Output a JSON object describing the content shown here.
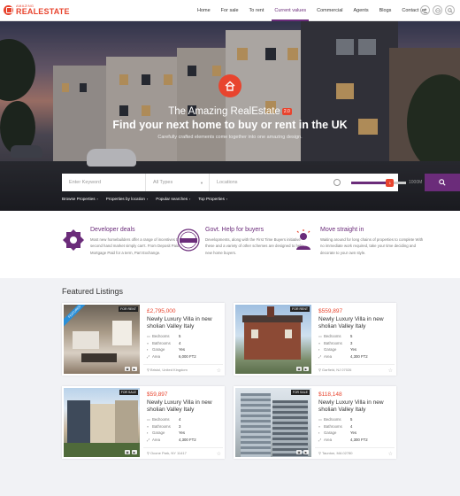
{
  "brand": {
    "small": "AMAZING",
    "big": "REALESTATE",
    "accent": "#e8442e",
    "primary": "#6b2c7a"
  },
  "nav": {
    "items": [
      "Home",
      "For sale",
      "To rent",
      "Current values",
      "Commercial",
      "Agents",
      "Blogs",
      "Contact us"
    ],
    "active": "Current values"
  },
  "header_icons": [
    "user-icon",
    "globe-icon",
    "search-icon"
  ],
  "hero": {
    "title1": "The Amazing RealEstate",
    "version": "2.0",
    "title2": "Find your next home to buy or rent in the UK",
    "subtitle": "Carefully crafted elements come together into one amazing design."
  },
  "search": {
    "keyword_placeholder": "Enter Keyword",
    "type_placeholder": "All Types",
    "location_placeholder": "Locations",
    "range_label": "1000M",
    "range_value": "1",
    "range_fill_fraction": 0.7
  },
  "quick_links": [
    "Browse Properties",
    "Properties by location",
    "Popular searches",
    "Top Properties"
  ],
  "features": [
    {
      "title": "Developer deals",
      "text": "Most new homebuilders offer a range of incentives that the second hand market simply can't. From Deposit Paid to Mortgage Paid for a term, Part Exchange."
    },
    {
      "title": "Govt. Help for buyers",
      "text": "Developments, along with the First Time Buyers initiative these and a variety of other schemes are designed to help new home buyers."
    },
    {
      "title": "Move straight in",
      "text": "Waiting around for long chains of properties to complete With no immediate work required, take your time deciding and decorate to your own style."
    }
  ],
  "featured": {
    "heading": "Featured Listings",
    "spec_labels": [
      "Bedrooms",
      "Bathrooms",
      "Garage",
      "Area"
    ],
    "listings": [
      {
        "price": "£2,795,000",
        "title": "Newly Luxury Villa in new sholian Valley Italy",
        "tag": "FOR RENT",
        "featured": "FEATURED",
        "specs": [
          "5",
          "4",
          "Yes",
          "6,000 FT2"
        ],
        "location": "Bristol, United Kingdom"
      },
      {
        "price": "$559,897",
        "title": "Newly Luxury Villa in new sholian Valley Italy",
        "tag": "FOR RENT",
        "specs": [
          "5",
          "3",
          "Yes",
          "4,300 FT2"
        ],
        "location": "Garfield, NJ 07026"
      },
      {
        "price": "$59,897",
        "title": "Newly Luxury Villa in new sholian Valley Italy",
        "tag": "FOR SALE",
        "specs": [
          "4",
          "3",
          "Yes",
          "4,300 FT2"
        ],
        "location": "Ocone Park, NY 11417"
      },
      {
        "price": "$118,148",
        "title": "Newly Luxury Villa in new sholian Valley Italy",
        "tag": "FOR SALE",
        "specs": [
          "5",
          "4",
          "Yes",
          "4,300 FT2"
        ],
        "location": "Taunton, MA 02780"
      }
    ]
  }
}
